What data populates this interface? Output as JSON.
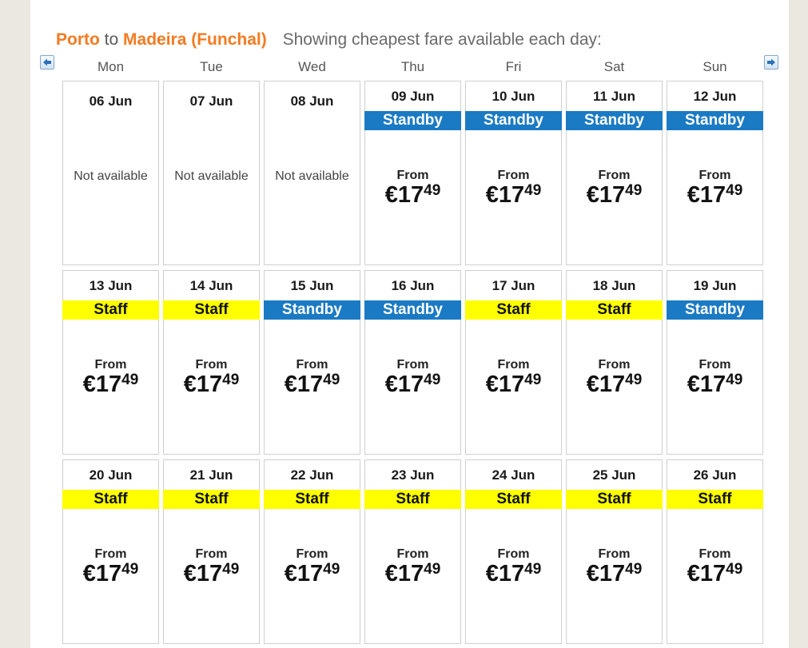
{
  "header": {
    "origin": "Porto",
    "connector": "to",
    "destination": "Madeira (Funchal)",
    "subtitle": "Showing cheapest fare available each day:"
  },
  "nav": {
    "prev_icon": "arrow-left-icon",
    "next_icon": "arrow-right-icon"
  },
  "weekdays": [
    "Mon",
    "Tue",
    "Wed",
    "Thu",
    "Fri",
    "Sat",
    "Sun"
  ],
  "colors": {
    "standby": "#1a7ac4",
    "staff": "#ffff00",
    "route": "#f47a20"
  },
  "labels": {
    "not_available": "Not available",
    "from": "From",
    "currency": "€"
  },
  "weeks": [
    [
      {
        "date": "06 Jun",
        "available": false
      },
      {
        "date": "07 Jun",
        "available": false
      },
      {
        "date": "08 Jun",
        "available": false
      },
      {
        "date": "09 Jun",
        "available": true,
        "type": "Standby",
        "price_int": "17",
        "price_dec": "49"
      },
      {
        "date": "10 Jun",
        "available": true,
        "type": "Standby",
        "price_int": "17",
        "price_dec": "49"
      },
      {
        "date": "11 Jun",
        "available": true,
        "type": "Standby",
        "price_int": "17",
        "price_dec": "49"
      },
      {
        "date": "12 Jun",
        "available": true,
        "type": "Standby",
        "price_int": "17",
        "price_dec": "49"
      }
    ],
    [
      {
        "date": "13 Jun",
        "available": true,
        "type": "Staff",
        "price_int": "17",
        "price_dec": "49"
      },
      {
        "date": "14 Jun",
        "available": true,
        "type": "Staff",
        "price_int": "17",
        "price_dec": "49"
      },
      {
        "date": "15 Jun",
        "available": true,
        "type": "Standby",
        "price_int": "17",
        "price_dec": "49"
      },
      {
        "date": "16 Jun",
        "available": true,
        "type": "Standby",
        "price_int": "17",
        "price_dec": "49"
      },
      {
        "date": "17 Jun",
        "available": true,
        "type": "Staff",
        "price_int": "17",
        "price_dec": "49"
      },
      {
        "date": "18 Jun",
        "available": true,
        "type": "Staff",
        "price_int": "17",
        "price_dec": "49"
      },
      {
        "date": "19 Jun",
        "available": true,
        "type": "Standby",
        "price_int": "17",
        "price_dec": "49"
      }
    ],
    [
      {
        "date": "20 Jun",
        "available": true,
        "type": "Staff",
        "price_int": "17",
        "price_dec": "49"
      },
      {
        "date": "21 Jun",
        "available": true,
        "type": "Staff",
        "price_int": "17",
        "price_dec": "49"
      },
      {
        "date": "22 Jun",
        "available": true,
        "type": "Staff",
        "price_int": "17",
        "price_dec": "49"
      },
      {
        "date": "23 Jun",
        "available": true,
        "type": "Staff",
        "price_int": "17",
        "price_dec": "49"
      },
      {
        "date": "24 Jun",
        "available": true,
        "type": "Staff",
        "price_int": "17",
        "price_dec": "49"
      },
      {
        "date": "25 Jun",
        "available": true,
        "type": "Staff",
        "price_int": "17",
        "price_dec": "49"
      },
      {
        "date": "26 Jun",
        "available": true,
        "type": "Staff",
        "price_int": "17",
        "price_dec": "49"
      }
    ]
  ]
}
